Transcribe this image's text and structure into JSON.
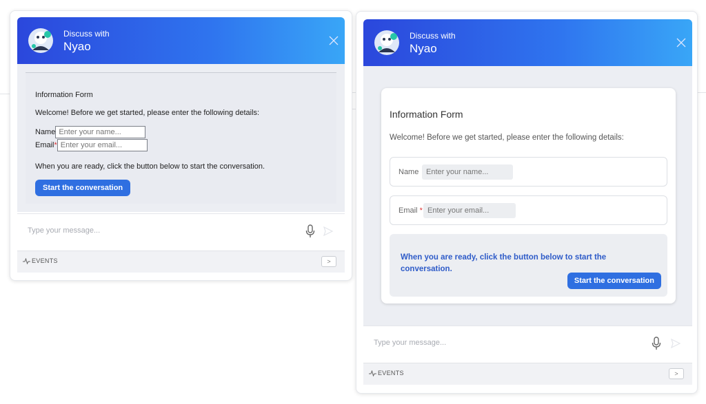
{
  "colors": {
    "header_start": "#2b47dc",
    "header_end": "#39a6f7",
    "primary_button": "#2f6fe1",
    "required": "#dd3333"
  },
  "widgets": [
    {
      "header": {
        "subtitle": "Discuss with",
        "title": "Nyao",
        "avatar_icon": "bot-avatar-icon",
        "close_icon": "close-icon"
      },
      "form": {
        "title": "Information Form",
        "welcome": "Welcome! Before we get started, please enter the following details:",
        "name_label": "Name",
        "name_placeholder": "Enter your name...",
        "email_label": "Email",
        "required_mark": "*",
        "email_placeholder": "Enter your email...",
        "ready_text": "When you are ready, click the button below to start the conversation.",
        "button": "Start the conversation"
      },
      "composer": {
        "placeholder": "Type your message...",
        "mic_icon": "microphone-icon",
        "send_icon": "send-icon"
      },
      "events": {
        "label": "EVENTS",
        "pulse_icon": "activity-icon",
        "toggle": ">"
      }
    },
    {
      "header": {
        "subtitle": "Discuss with",
        "title": "Nyao",
        "avatar_icon": "bot-avatar-icon",
        "close_icon": "close-icon"
      },
      "form": {
        "title": "Information Form",
        "welcome": "Welcome! Before we get started, please enter the following details:",
        "name_label": "Name",
        "name_placeholder": "Enter your name...",
        "email_label": "Email",
        "required_mark": "*",
        "email_placeholder": "Enter your email...",
        "ready_text": "When you are ready, click the button below to start the conversation.",
        "button": "Start the conversation"
      },
      "composer": {
        "placeholder": "Type your message...",
        "mic_icon": "microphone-icon",
        "send_icon": "send-icon"
      },
      "events": {
        "label": "EVENTS",
        "pulse_icon": "activity-icon",
        "toggle": ">"
      }
    }
  ]
}
